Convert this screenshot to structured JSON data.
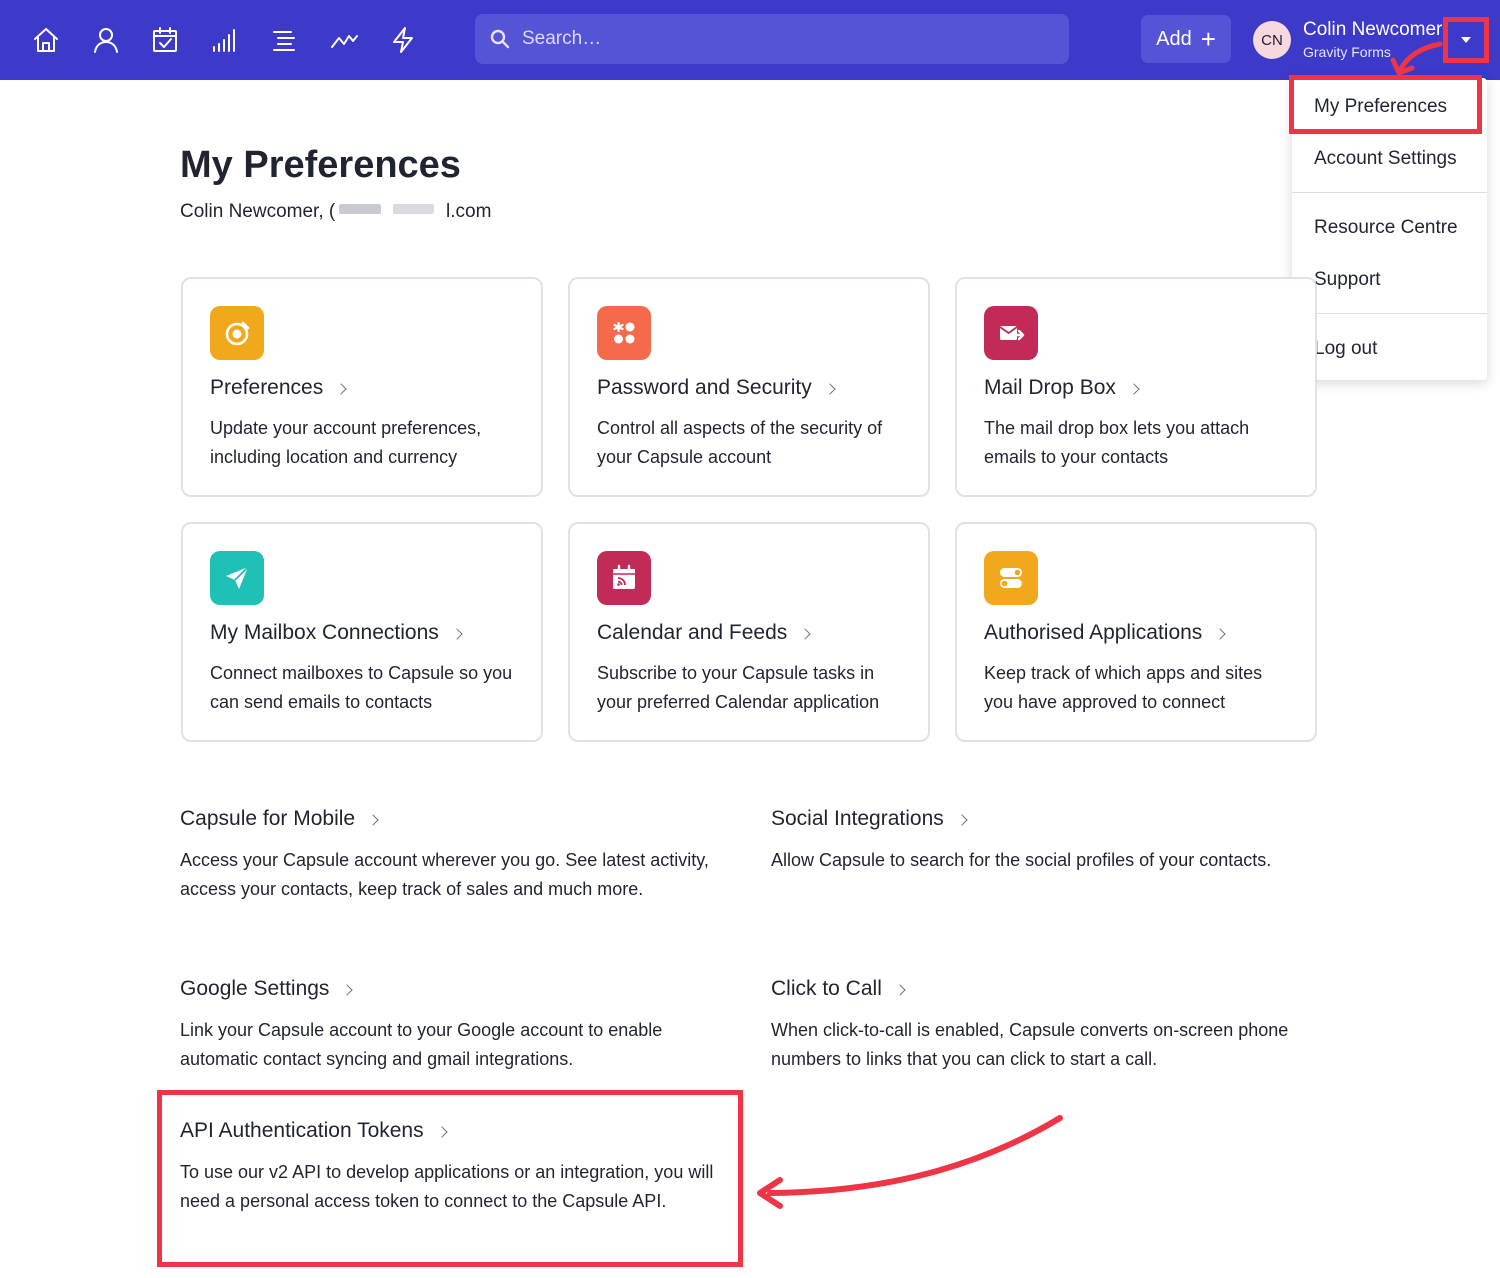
{
  "topbar": {
    "nav_icons": [
      "home-icon",
      "person-icon",
      "calendar-check-icon",
      "signal-bars-icon",
      "list-icon",
      "trend-line-icon",
      "lightning-icon"
    ],
    "search_placeholder": "Search…",
    "add_label": "Add",
    "add_plus": "+",
    "avatar_initials": "CN",
    "user_name": "Colin Newcomer",
    "user_org": "Gravity Forms"
  },
  "menu": {
    "items": [
      "My Preferences",
      "Account Settings",
      "Resource Centre",
      "Support",
      "Log out"
    ]
  },
  "page": {
    "title": "My Preferences",
    "subtitle_name": "Colin Newcomer, (",
    "subtitle_email_end": "l.com"
  },
  "cards": [
    {
      "title": "Preferences",
      "desc": "Update your account preferences, including location and currency",
      "icon": "preferences-icon",
      "color": "#f2a81d"
    },
    {
      "title": "Password and Security",
      "desc": "Control all aspects of the security of your Capsule account",
      "icon": "security-dots-icon",
      "color": "#f56a4a"
    },
    {
      "title": "Mail Drop Box",
      "desc": "The mail drop box lets you attach emails to your contacts",
      "icon": "mail-drop-icon",
      "color": "#c22a57"
    },
    {
      "title": "My Mailbox Connections",
      "desc": "Connect mailboxes to Capsule so you can send emails to contacts",
      "icon": "paper-plane-icon",
      "color": "#1fc0b6"
    },
    {
      "title": "Calendar and Feeds",
      "desc": "Subscribe to your Capsule tasks in your preferred Calendar application",
      "icon": "calendar-feed-icon",
      "color": "#c22a57"
    },
    {
      "title": "Authorised Applications",
      "desc": "Keep track of which apps and sites you have approved to connect",
      "icon": "toggles-icon",
      "color": "#f2a81d"
    }
  ],
  "sections": [
    {
      "title": "Capsule for Mobile",
      "desc": "Access your Capsule account wherever you go. See latest activity, access your contacts, keep track of sales and much more."
    },
    {
      "title": "Social Integrations",
      "desc": "Allow Capsule to search for the social profiles of your contacts."
    },
    {
      "title": "Google Settings",
      "desc": "Link your Capsule account to your Google account to enable automatic contact syncing and gmail integrations."
    },
    {
      "title": "Click to Call",
      "desc": "When click-to-call is enabled, Capsule converts on-screen phone numbers to links that you can click to start a call."
    },
    {
      "title": "API Authentication Tokens",
      "desc": "To use our v2 API to develop applications or an integration, you will need a personal access token to connect to the Capsule API."
    }
  ],
  "colors": {
    "topbar": "#3d39c9",
    "highlight": "#ee3445"
  }
}
